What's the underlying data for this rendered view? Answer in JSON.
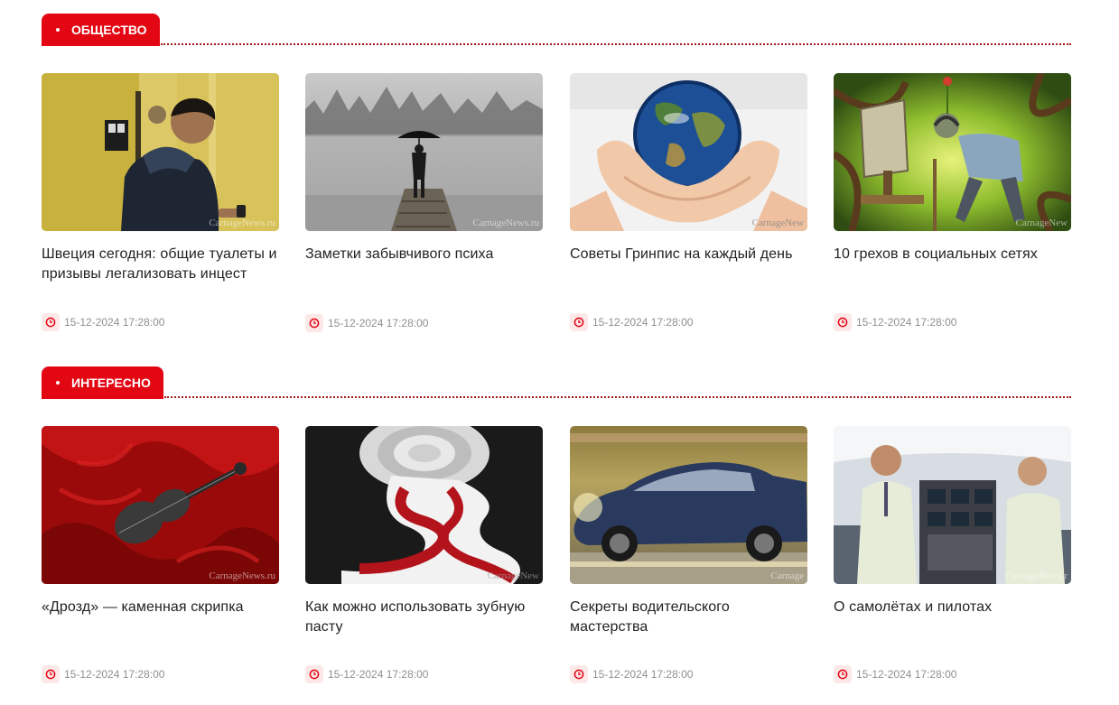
{
  "sections": [
    {
      "title": "ОБЩЕСТВО",
      "cards": [
        {
          "title": "Швеция сегодня: общие туалеты и призывы легализовать инцест",
          "date": "15-12-2024 17:28:00",
          "watermark": "CarnageNews.ru"
        },
        {
          "title": "Заметки забывчивого психа",
          "date": "15-12-2024 17:28:00",
          "watermark": "CarnageNews.ru"
        },
        {
          "title": "Советы Гринпис на каждый день",
          "date": "15-12-2024 17:28:00",
          "watermark": "CarnageNew"
        },
        {
          "title": "10 грехов в социальных сетях",
          "date": "15-12-2024 17:28:00",
          "watermark": "CarnageNew"
        }
      ]
    },
    {
      "title": "ИНТЕРЕСНО",
      "cards": [
        {
          "title": "«Дрозд» — каменная скрипка",
          "date": "15-12-2024 17:28:00",
          "watermark": "CarnageNews.ru"
        },
        {
          "title": "Как можно использовать зубную пасту",
          "date": "15-12-2024 17:28:00",
          "watermark": "CarnageNew"
        },
        {
          "title": "Секреты водительского мастерства",
          "date": "15-12-2024 17:28:00",
          "watermark": "Carnage"
        },
        {
          "title": "О самолётах и пилотах",
          "date": "15-12-2024 17:28:00",
          "watermark": "CarnageNews.r"
        }
      ]
    }
  ],
  "icons": {
    "date": "clock-icon"
  },
  "colors": {
    "accent": "#e30613",
    "dotted_line": "#a1161c",
    "date_text": "#8f8f8f",
    "icon_bg": "#fde8e8"
  }
}
